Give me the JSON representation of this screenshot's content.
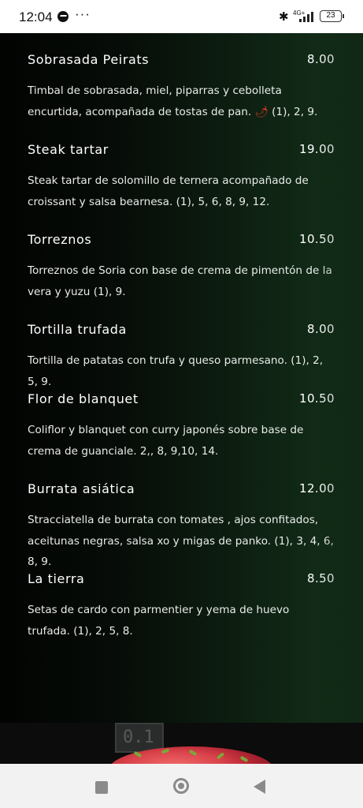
{
  "status_bar": {
    "time": "12:04",
    "overflow_dots": "···",
    "network_label": "4G+",
    "battery": "23",
    "icons": [
      "messenger-icon",
      "bluetooth-icon",
      "signal-icon",
      "battery-icon"
    ]
  },
  "menu": {
    "items": [
      {
        "name": "Sobrasada Peirats",
        "price": "8.00",
        "description": "Timbal de sobrasada, miel, piparras y cebolleta encurtida, acompañada de tostas de pan.",
        "spicy_icon": "🌶",
        "description_tail": " (1), 2, 9."
      },
      {
        "name": "Steak tartar",
        "price": "19.00",
        "description": "Steak tartar de solomillo de ternera acompañado de croissant y salsa bearnesa. (1), 5, 6, 8, 9, 12."
      },
      {
        "name": "Torreznos",
        "price": "10.50",
        "description": "Torreznos de Soria con base de crema de pimentón de la vera y yuzu (1), 9."
      },
      {
        "name": "Tortilla trufada",
        "price": "8.00",
        "description": "Tortilla de patatas con trufa y queso parmesano. (1), 2, 5, 9."
      },
      {
        "name": "Flor de blanquet",
        "price": "10.50",
        "description": "Coliflor y blanquet con curry japonés sobre base de crema de guanciale. 2,, 8, 9,10, 14."
      },
      {
        "name": "Burrata asiática",
        "price": "12.00",
        "description": "Stracciatella de burrata con tomates , ajos confitados, aceitunas negras, salsa xo y migas de panko. (1), 3, 4, 6, 8, 9."
      },
      {
        "name": "La tierra",
        "price": "8.50",
        "description": "Setas de cardo con parmentier y yema de huevo trufada. (1), 2, 5, 8."
      }
    ]
  },
  "food_photo": {
    "sign_text": "0.1"
  },
  "colors": {
    "menu_bg_left": "#020302",
    "menu_bg_right": "#14301a",
    "text": "#ffffff",
    "chili": "#e23a22"
  },
  "nav_bar": {
    "buttons": [
      "recent-apps-icon",
      "home-icon",
      "back-icon"
    ]
  }
}
